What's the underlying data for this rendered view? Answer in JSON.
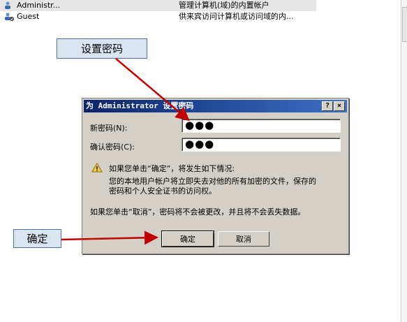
{
  "list": {
    "rows": [
      {
        "name": "Administr...",
        "desc": "管理计算机(域)的内置帐户"
      },
      {
        "name": "Guest",
        "desc": "供来宾访问计算机或访问域的内..."
      }
    ]
  },
  "callouts": {
    "set_password": "设置密码",
    "ok": "确定"
  },
  "dialog": {
    "title": "为 Administrator 设置密码",
    "help_label": "?",
    "close_label": "×",
    "new_password_label": "新密码(N):",
    "new_password_value": "●●●",
    "confirm_password_label": "确认密码(C):",
    "confirm_password_value": "●●●",
    "warning_heading": "如果您单击“确定”，将发生如下情况:",
    "warning_body_1": "您的本地用户帐户将立即失去对他的所有加密的文件，保存的",
    "warning_body_2": "密码和个人安全证书的访问权。",
    "cancel_note": "如果您单击“取消”，密码将不会被更改，并且将不会丢失数据。",
    "ok_label": "确定",
    "cancel_label": "取消"
  },
  "colors": {
    "arrow": "#c00000",
    "callout_bg": "#dbe5f1",
    "title_bar": "#0a246a"
  }
}
